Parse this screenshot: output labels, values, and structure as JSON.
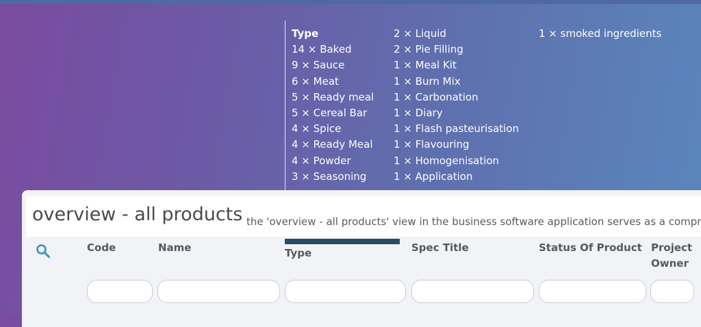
{
  "facet": {
    "heading": "Type",
    "col1": [
      "14 × Baked",
      "9 × Sauce",
      "6 × Meat",
      "5 × Ready meal",
      "5 × Cereal Bar",
      "4 × Spice",
      "4 × Ready Meal",
      "4 × Powder",
      "3 × Seasoning"
    ],
    "col2": [
      "2 × Liquid",
      "2 × Pie Filling",
      "1 × Meal Kit",
      "1 × Burn Mix",
      "1 × Carbonation",
      "1 × Diary",
      "1 × Flash pasteurisation",
      "1 × Flavouring",
      "1 × Homogenisation",
      "1 × Application"
    ],
    "col3": [
      "1 × smoked ingredients"
    ]
  },
  "header": {
    "title": "overview - all products",
    "description": "the 'overview - all products' view in the business software application serves as a comprehensive"
  },
  "table": {
    "search_icon": "search-icon",
    "columns": {
      "code": "Code",
      "name": "Name",
      "type": "Type",
      "spec_title": "Spec Title",
      "status": "Status Of Product",
      "owner_line1": "Project",
      "owner_line2": "Owner"
    },
    "filters": {
      "code": "",
      "name": "",
      "type": "",
      "spec_title": "",
      "status": "",
      "owner": ""
    }
  },
  "colors": {
    "accent_bar": "#2a4a66",
    "search_icon": "#4a94c8",
    "card_bg": "#f1f3f7"
  }
}
